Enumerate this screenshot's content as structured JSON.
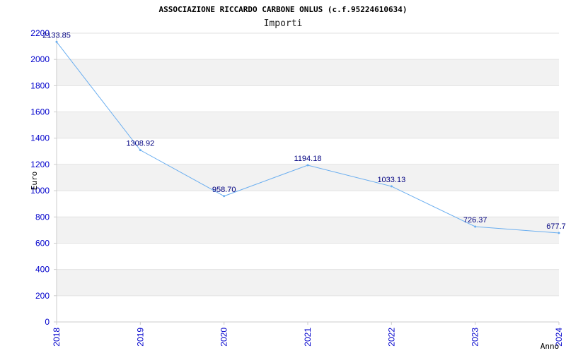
{
  "chart_data": {
    "type": "line",
    "title": "ASSOCIAZIONE RICCARDO CARBONE ONLUS (c.f.95224610634)",
    "subtitle": "Importi",
    "xlabel": "Anno",
    "ylabel": "Euro",
    "x": [
      "2018",
      "2019",
      "2020",
      "2021",
      "2022",
      "2023",
      "2024"
    ],
    "y": [
      2133.85,
      1308.92,
      958.7,
      1194.18,
      1033.13,
      726.37,
      677.7
    ],
    "data_labels": [
      "2133.85",
      "1308.92",
      "958.70",
      "1194.18",
      "1033.13",
      "726.37",
      "677.7"
    ],
    "ylim": [
      0,
      2200
    ],
    "yticks": [
      0,
      200,
      400,
      600,
      800,
      1000,
      1200,
      1400,
      1600,
      1800,
      2000,
      2200
    ],
    "grid": true,
    "colors": {
      "line": "#6aaef0",
      "band": "#f2f2f2",
      "tick_text": "#0000cc",
      "data_label": "#000080",
      "axis": "#cccccc"
    }
  }
}
